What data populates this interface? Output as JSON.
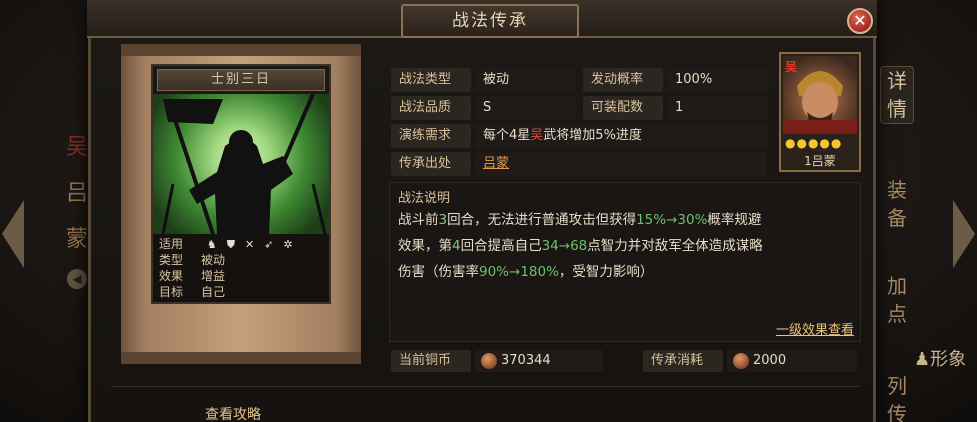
{
  "dialog": {
    "title": "战法传承",
    "close_icon": "close-icon"
  },
  "background": {
    "left_chars": [
      "吴",
      "吕",
      "蒙"
    ],
    "right_tabs": [
      {
        "label": [
          "详",
          "情"
        ],
        "active": true
      },
      {
        "label": [
          "装",
          "备"
        ],
        "active": false
      },
      {
        "label": [
          "加",
          "点"
        ],
        "active": false
      },
      {
        "label": [
          "列",
          "传"
        ],
        "active": false
      }
    ],
    "right_tag": "形象"
  },
  "tactic_card": {
    "name": "士别三日",
    "stats": {
      "use_label": "适用",
      "use_icons": [
        "cavalry-icon",
        "shield-icon",
        "crossed-spears-icon",
        "archer-icon",
        "vehicle-icon"
      ],
      "type_label": "类型",
      "type_value": "被动",
      "effect_label": "效果",
      "effect_value": "增益",
      "target_label": "目标",
      "target_value": "自己"
    }
  },
  "info": {
    "type_label": "战法类型",
    "type_value": "被动",
    "rate_label": "发动概率",
    "rate_value": "100%",
    "quality_label": "战法品质",
    "quality_value": "S",
    "equip_label": "可装配数",
    "equip_value": "1",
    "drill_label": "演练需求",
    "drill_value_pre": "每个4星",
    "drill_value_faction": "吴",
    "drill_value_post": "武将增加5%进度",
    "source_label": "传承出处",
    "source_value": "吕蒙"
  },
  "general": {
    "faction": "吴",
    "stars": "●●●●●",
    "name": "1吕蒙"
  },
  "description": {
    "title": "战法说明",
    "line1_pre": "战斗前",
    "line1_num": "3",
    "line1_mid": "回合，无法进行普通攻击但获得",
    "line1_range": "15%→30%",
    "line1_post": "概率规避",
    "line2_pre": "效果，第",
    "line2_num": "4",
    "line2_mid": "回合提高自己",
    "line2_range": "34→68",
    "line2_post": "点智力并对敌军全体造成谋略",
    "line3_pre": "伤害（伤害率",
    "line3_range": "90%→180%",
    "line3_post": "，受智力影响）",
    "link": "一级效果查看"
  },
  "currency": {
    "current_label": "当前铜币",
    "current_value": "370344",
    "cost_label": "传承消耗",
    "cost_value": "2000"
  },
  "footer": {
    "guide_link": "查看攻略"
  }
}
